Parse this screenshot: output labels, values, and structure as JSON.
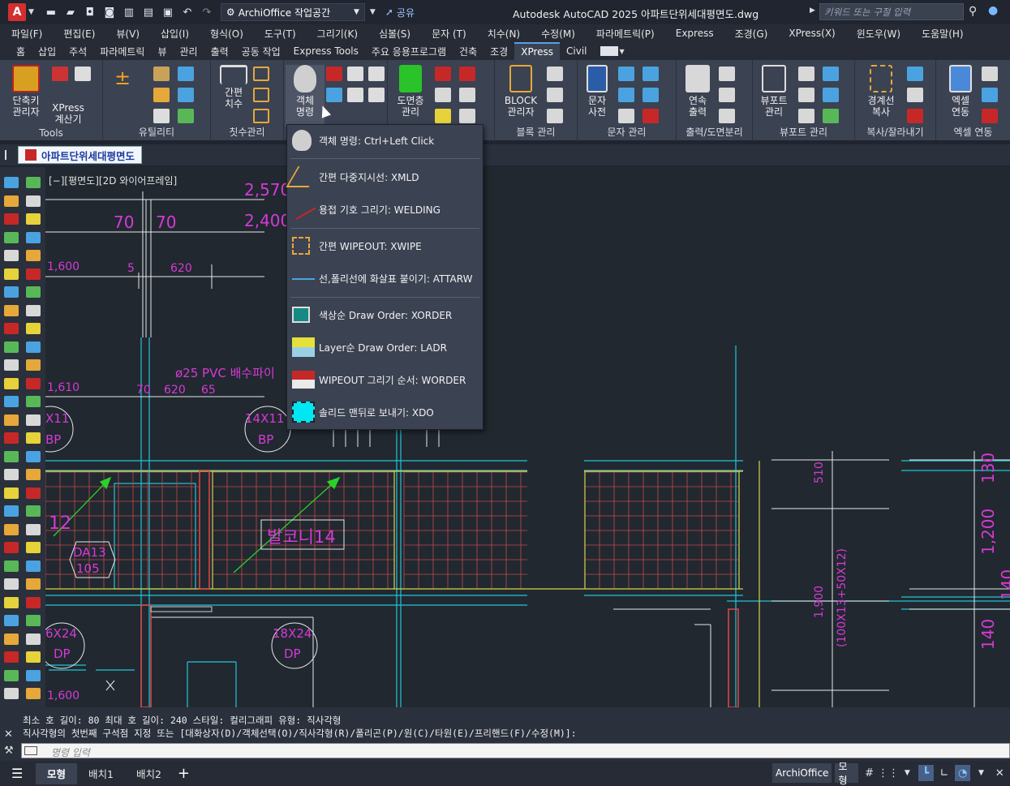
{
  "titlebar": {
    "app_logo": "A",
    "workspace": "ArchiOffice 작업공간",
    "share": "공유",
    "title": "Autodesk AutoCAD 2025    아파트단위세대평면도.dwg",
    "search_placeholder": "키워드 또는 구절 입력"
  },
  "menubar": [
    "파일(F)",
    "편집(E)",
    "뷰(V)",
    "삽입(I)",
    "형식(O)",
    "도구(T)",
    "그리기(K)",
    "심볼(S)",
    "문자 (T)",
    "치수(N)",
    "수정(M)",
    "파라메트릭(P)",
    "Express",
    "조경(G)",
    "XPress(X)",
    "윈도우(W)",
    "도움말(H)"
  ],
  "ribbon_tabs": [
    "홈",
    "삽입",
    "주석",
    "파라메트릭",
    "뷰",
    "관리",
    "출력",
    "공동 작업",
    "Express Tools",
    "주요 응용프로그램",
    "건축",
    "조경",
    "XPress",
    "Civil"
  ],
  "active_tab": "XPress",
  "panels": [
    {
      "title": "Tools",
      "buttons": [
        "단축키\n관리자",
        "XPress\n계산기"
      ]
    },
    {
      "title": "유틸리티"
    },
    {
      "title": "칫수관리",
      "buttons": [
        "간편\n치수"
      ]
    },
    {
      "title": "",
      "buttons": [
        "객체\n명령"
      ]
    },
    {
      "title": "",
      "buttons": [
        "도면층\n관리"
      ]
    },
    {
      "title": "블록 관리",
      "buttons": [
        "BLOCK\n관리자"
      ]
    },
    {
      "title": "문자 관리",
      "buttons": [
        "문자\n사전"
      ]
    },
    {
      "title": "출력/도면분리",
      "buttons": [
        "연속\n출력"
      ]
    },
    {
      "title": "뷰포트 관리",
      "buttons": [
        "뷰포트\n관리"
      ]
    },
    {
      "title": "복사/잘라내기",
      "buttons": [
        "경계선\n복사"
      ]
    },
    {
      "title": "엑셀 연동",
      "buttons": [
        "엑셀\n연동"
      ]
    }
  ],
  "doc_tab": "아파트단위세대평면도",
  "view_label": "[−][평면도][2D 와이어프레임]",
  "dropdown": [
    "객체 명령: Ctrl+Left Click",
    "간편 다중지시선: XMLD",
    "용접 기호 그리기: WELDING",
    "간편 WIPEOUT: XWIPE",
    "선,폴리선에 화살표 붙이기: ATTARW",
    "색상순 Draw Order: XORDER",
    "Layer순 Draw Order: LADR",
    "WIPEOUT 그리기 순서: WORDER",
    "솔리드 맨뒤로 보내기: XDO"
  ],
  "drawing_text": {
    "dim_2570": "2,570",
    "dim_2400": "2,400",
    "dim_70a": "70",
    "dim_70b": "70",
    "dim_1600": "1,600",
    "dim_5": "5",
    "dim_620": "620",
    "pvc": "ø25 PVC 배수파이",
    "dim_1610": "1,610",
    "dim_70c": "70",
    "dim_620b": "620",
    "dim_65": "65",
    "bubble_1_top": "X11",
    "bubble_1_bot": "BP",
    "bubble_2_top": "14X11",
    "bubble_2_bot": "BP",
    "room_label": "발코니14",
    "tag_top": "DA13",
    "tag_bot": "105",
    "lbl_12": "12",
    "bubble_3_top": "6X24",
    "bubble_3_bot": "DP",
    "bubble_4_top": "18X24",
    "bubble_4_bot": "DP",
    "dim_600": "1,600",
    "dim_510": "510",
    "dim_1900": "1,900",
    "dim_100x13": "(100X13+50X12)",
    "dim_130": "130",
    "dim_1200": "1,200",
    "dim_140": "140",
    "dim_140b": "140"
  },
  "command_line": {
    "line1": "최소 호 길이: 80  최대 호 길이: 240  스타일: 컬리그래피  유형: 직사각형",
    "line2": "직사각형의 첫번째 구석점 지정 또는 [대화상자(D)/객체선택(O)/직사각형(R)/폴리곤(P)/원(C)/타원(E)/프리핸드(F)/수정(M)]:",
    "placeholder": "명령 입력"
  },
  "statusbar": {
    "tabs": [
      "모형",
      "배치1",
      "배치2"
    ],
    "active": "모형",
    "right_label": "ArchiOffice",
    "model_label": "모형"
  },
  "colors": {
    "magenta": "#d63ad6",
    "cyan": "#22c5d6",
    "red": "#e04848",
    "yellow": "#d9d247",
    "white": "#e8e8e8",
    "green": "#2ad12a"
  }
}
